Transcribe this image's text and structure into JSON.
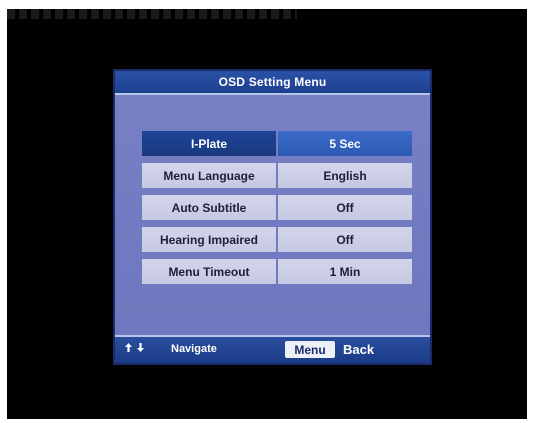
{
  "menu": {
    "title": "OSD Setting Menu",
    "rows": [
      {
        "label": "I-Plate",
        "value": "5 Sec",
        "selected": true
      },
      {
        "label": "Menu Language",
        "value": "English",
        "selected": false
      },
      {
        "label": "Auto Subtitle",
        "value": "Off",
        "selected": false
      },
      {
        "label": "Hearing Impaired",
        "value": "Off",
        "selected": false
      },
      {
        "label": "Menu Timeout",
        "value": "1 Min",
        "selected": false
      }
    ]
  },
  "footer": {
    "nav_icons": [
      "arrow-up-icon",
      "arrow-down-icon"
    ],
    "nav_label": "Navigate",
    "menu_key": "Menu",
    "back_label": "Back"
  },
  "colors": {
    "background": "#000000",
    "panel": "#727bc1",
    "header": "#1d3f8f",
    "selected_label": "#1f4597",
    "selected_value": "#3a6bc8",
    "row_normal": "#cdd0e7"
  }
}
